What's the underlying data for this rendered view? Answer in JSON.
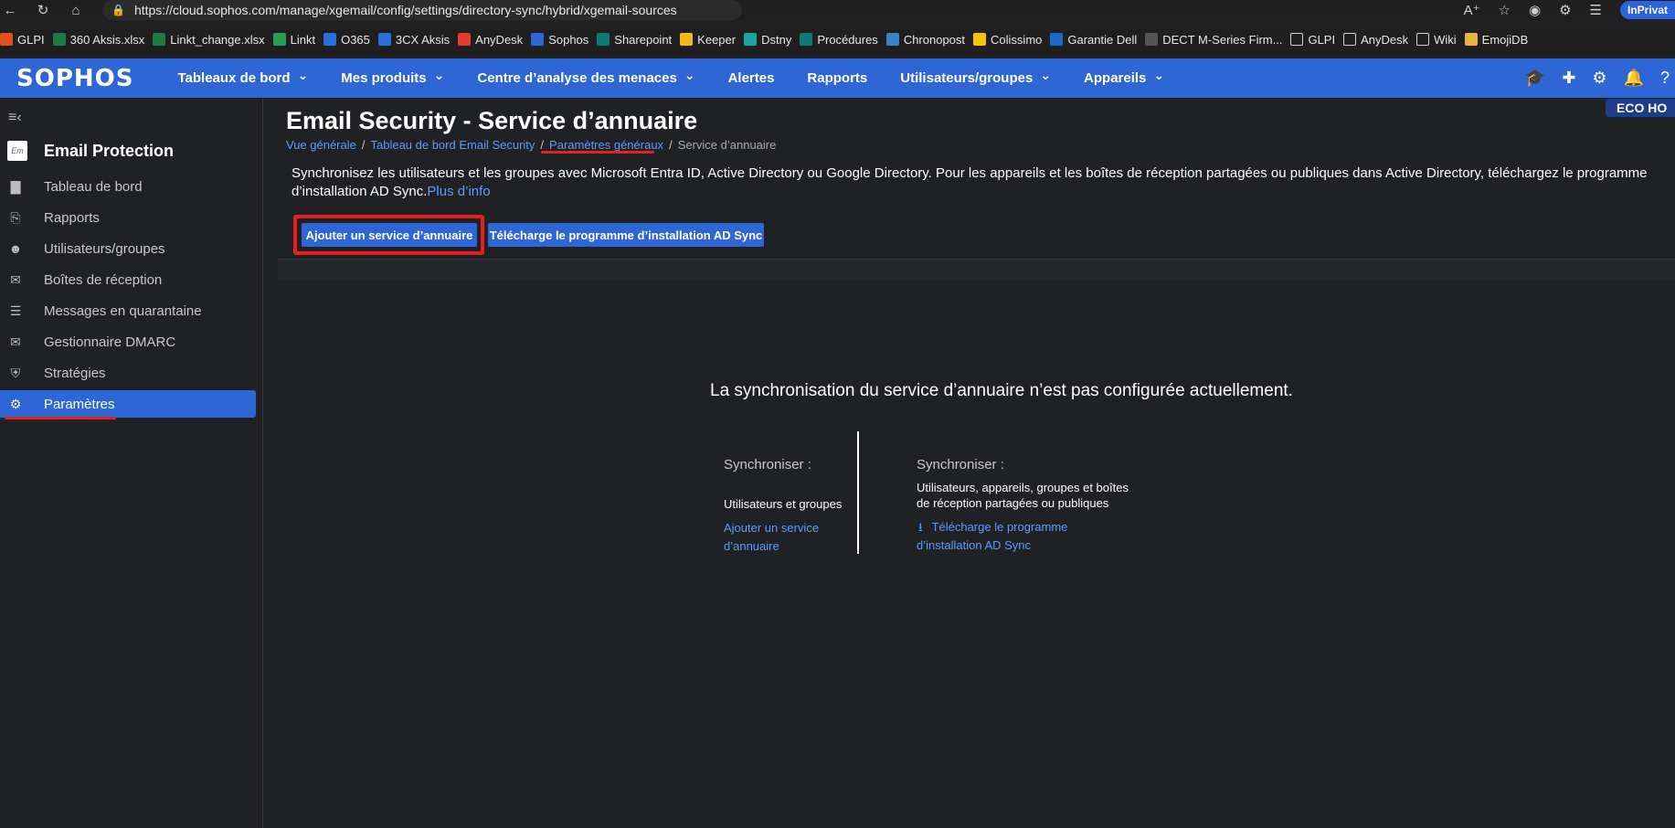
{
  "browser": {
    "url": "https://cloud.sophos.com/manage/xgemail/config/settings/directory-sync/hybrid/xgemail-sources",
    "inprivate_label": "InPrivat",
    "bookmarks": [
      {
        "label": "GLPI",
        "icon": "windows-icon",
        "color": "#e1501e"
      },
      {
        "label": "360 Aksis.xlsx",
        "icon": "excel-icon",
        "color": "#1d7a43"
      },
      {
        "label": "Linkt_change.xlsx",
        "icon": "excel-icon",
        "color": "#1d7a43"
      },
      {
        "label": "Linkt",
        "icon": "linkt-icon",
        "color": "#2a9d55"
      },
      {
        "label": "O365",
        "icon": "o365-icon",
        "color": "#2b6fd8"
      },
      {
        "label": "3CX Aksis",
        "icon": "3cx-icon",
        "color": "#2b6fd8"
      },
      {
        "label": "AnyDesk",
        "icon": "anydesk-icon",
        "color": "#e33b2c"
      },
      {
        "label": "Sophos",
        "icon": "sophos-icon",
        "color": "#2f66d6"
      },
      {
        "label": "Sharepoint",
        "icon": "sharepoint-icon",
        "color": "#0b7a75"
      },
      {
        "label": "Keeper",
        "icon": "keeper-icon",
        "color": "#f0b818"
      },
      {
        "label": "Dstny",
        "icon": "dstny-icon",
        "color": "#1aa6a0"
      },
      {
        "label": "Procédures",
        "icon": "sharepoint-icon",
        "color": "#0b7a75"
      },
      {
        "label": "Chronopost",
        "icon": "chronopost-icon",
        "color": "#3b82c4"
      },
      {
        "label": "Colissimo",
        "icon": "colissimo-icon",
        "color": "#f6c200"
      },
      {
        "label": "Garantie Dell",
        "icon": "dell-icon",
        "color": "#1b6ac9"
      },
      {
        "label": "DECT M-Series Firm...",
        "icon": "page-icon",
        "color": "#555555"
      },
      {
        "label": "GLPI",
        "icon": "folder-icon",
        "color": "#1f1f1f"
      },
      {
        "label": "AnyDesk",
        "icon": "folder-icon",
        "color": "#1f1f1f"
      },
      {
        "label": "Wiki",
        "icon": "folder-icon",
        "color": "#1f1f1f"
      },
      {
        "label": "EmojiDB",
        "icon": "folder-yellow-icon",
        "color": "#e8b43b"
      }
    ]
  },
  "topnav": {
    "logo": "SOPHOS",
    "menu": [
      {
        "label": "Tableaux de bord",
        "dropdown": true
      },
      {
        "label": "Mes produits",
        "dropdown": true
      },
      {
        "label": "Centre d’analyse des menaces",
        "dropdown": true
      },
      {
        "label": "Alertes",
        "dropdown": false
      },
      {
        "label": "Rapports",
        "dropdown": false
      },
      {
        "label": "Utilisateurs/groupes",
        "dropdown": true
      },
      {
        "label": "Appareils",
        "dropdown": true
      }
    ]
  },
  "sidebar": {
    "product_icon_text": "Em",
    "product_name": "Email Protection",
    "items": [
      {
        "label": "Tableau de bord",
        "icon": "bar-chart-icon"
      },
      {
        "label": "Rapports",
        "icon": "clipboard-icon"
      },
      {
        "label": "Utilisateurs/groupes",
        "icon": "users-icon"
      },
      {
        "label": "Boîtes de réception",
        "icon": "envelope-icon"
      },
      {
        "label": "Messages en quarantaine",
        "icon": "list-icon"
      },
      {
        "label": "Gestionnaire DMARC",
        "icon": "mail-lock-icon"
      },
      {
        "label": "Stratégies",
        "icon": "shield-icon"
      },
      {
        "label": "Paramètres",
        "icon": "gear-icon",
        "active": true
      }
    ]
  },
  "main": {
    "title": "Email Security - Service d’annuaire",
    "eco_tag": "ECO HO",
    "breadcrumb": {
      "item1": "Vue générale",
      "item2": "Tableau de bord Email Security",
      "item3": "Paramètres généraux",
      "current": "Service d’annuaire"
    },
    "description": "Synchronisez les utilisateurs et les groupes avec Microsoft Entra ID, Active Directory ou Google Directory. Pour les appareils et les boîtes de réception partagées ou publiques dans Active Directory, téléchargez le programme d’installation AD Sync.",
    "more_link": "Plus d’info",
    "add_button": "Ajouter un service d’annuaire",
    "download_button": "Télécharge le programme d’installation AD Sync",
    "empty_message": "La synchronisation du service d’annuaire n’est pas configurée actuellement.",
    "left_col": {
      "label": "Synchroniser :",
      "desc": "Utilisateurs et groupes",
      "link_line1": "Ajouter un service",
      "link_line2": "d’annuaire"
    },
    "right_col": {
      "label": "Synchroniser :",
      "desc_line1": "Utilisateurs, appareils, groupes et boîtes",
      "desc_line2": "de réception partagées ou publiques",
      "link_line1": "Télécharge le programme",
      "link_line2": "d’installation AD Sync"
    }
  },
  "colors": {
    "brand_blue": "#2f66d6",
    "link_blue": "#5b9cff",
    "annotation_red": "#e8201d",
    "background": "#202124"
  }
}
